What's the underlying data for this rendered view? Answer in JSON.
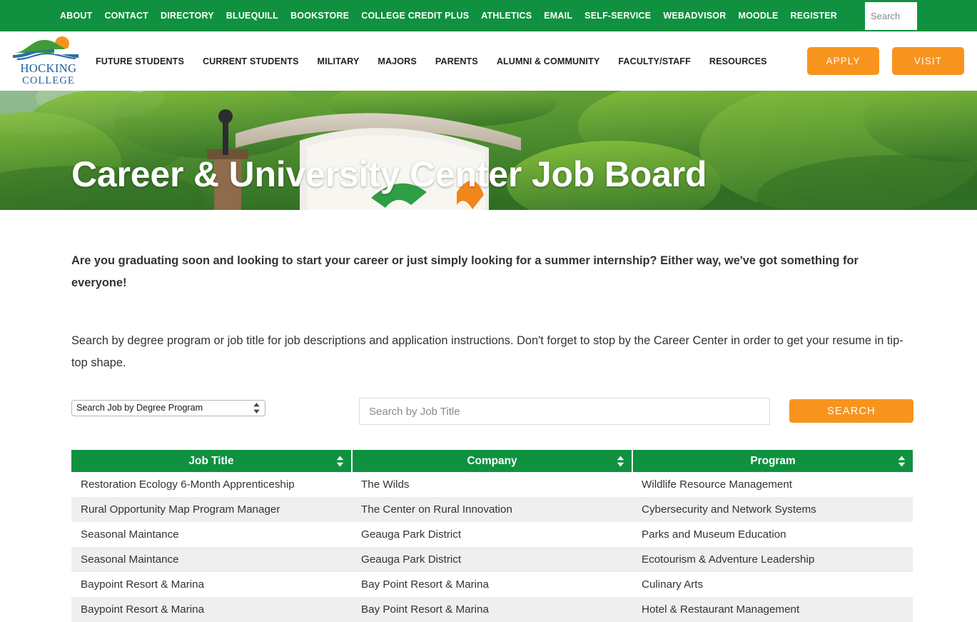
{
  "topbar": {
    "links": [
      {
        "label": "ABOUT"
      },
      {
        "label": "CONTACT"
      },
      {
        "label": "DIRECTORY"
      },
      {
        "label": "BLUEQUILL"
      },
      {
        "label": "BOOKSTORE"
      },
      {
        "label": "COLLEGE CREDIT PLUS"
      },
      {
        "label": "ATHLETICS"
      },
      {
        "label": "EMAIL"
      },
      {
        "label": "SELF-SERVICE"
      },
      {
        "label": "WEBADVISOR"
      },
      {
        "label": "MOODLE"
      },
      {
        "label": "REGISTER"
      }
    ],
    "search_placeholder": "Search",
    "search_value": "",
    "background_color": "#0f9140"
  },
  "header": {
    "logo": {
      "line1": "HOCKING",
      "line2": "COLLEGE",
      "hill_color": "#3f9c35",
      "sun_color": "#f7941e",
      "wave_color": "#2e6da4",
      "word_color": "#1f5c99"
    },
    "nav": [
      {
        "label": "FUTURE STUDENTS"
      },
      {
        "label": "CURRENT STUDENTS"
      },
      {
        "label": "MILITARY"
      },
      {
        "label": "MAJORS"
      },
      {
        "label": "PARENTS"
      },
      {
        "label": "ALUMNI & COMMUNITY"
      },
      {
        "label": "FACULTY/STAFF"
      },
      {
        "label": "RESOURCES"
      }
    ],
    "apply_label": "APPLY",
    "visit_label": "VISIT",
    "cta_color": "#f7941e"
  },
  "hero": {
    "title": "Career & University Center Job Board"
  },
  "main": {
    "lede": "Are you graduating soon and looking to start your career or just simply looking for a summer internship? Either way, we've got something for everyone!",
    "paragraph": "Search by degree program or job title for job descriptions and application instructions. Don't forget to stop by the Career Center in order to get your resume in tip-top shape.",
    "degree_select_value": "Search Job by Degree Program",
    "job_title_placeholder": "Search by Job Title",
    "job_title_value": "",
    "search_button_label": "SEARCH"
  },
  "table": {
    "header_color": "#0f9140",
    "columns": [
      {
        "label": "Job Title"
      },
      {
        "label": "Company"
      },
      {
        "label": "Program"
      }
    ],
    "rows": [
      {
        "job_title": "Restoration Ecology 6-Month Apprenticeship",
        "company": "The Wilds",
        "program": "Wildlife Resource Management"
      },
      {
        "job_title": "Rural Opportunity Map Program Manager",
        "company": "The Center on Rural Innovation",
        "program": "Cybersecurity and Network Systems"
      },
      {
        "job_title": "Seasonal Maintance",
        "company": "Geauga Park District",
        "program": "Parks and Museum Education"
      },
      {
        "job_title": "Seasonal Maintance",
        "company": "Geauga Park District",
        "program": "Ecotourism & Adventure Leadership"
      },
      {
        "job_title": "Baypoint Resort & Marina",
        "company": "Bay Point Resort & Marina",
        "program": "Culinary Arts"
      },
      {
        "job_title": "Baypoint Resort & Marina",
        "company": "Bay Point Resort & Marina",
        "program": "Hotel & Restaurant Management"
      }
    ]
  }
}
